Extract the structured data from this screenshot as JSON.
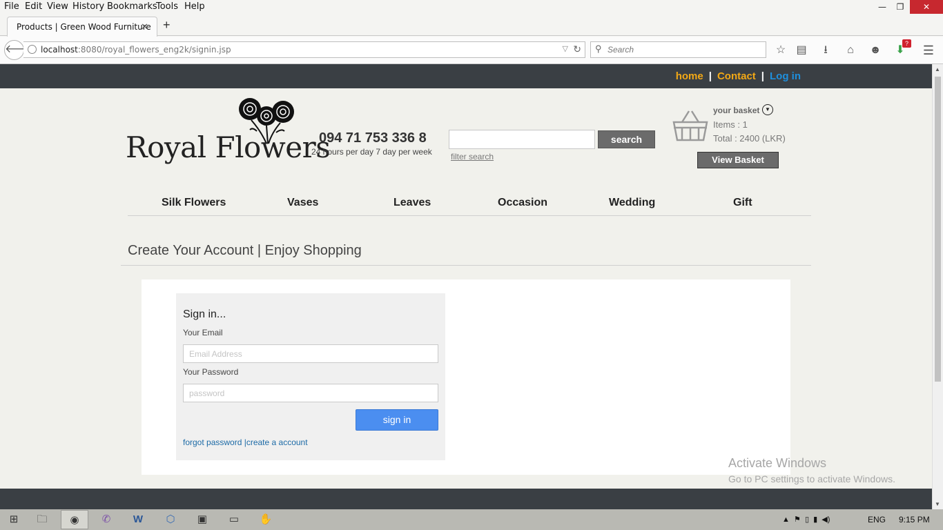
{
  "browser": {
    "menu": [
      "File",
      "Edit",
      "View",
      "History",
      "Bookmarks",
      "Tools",
      "Help"
    ],
    "tab_title": "Products | Green Wood Furniture",
    "url_host": "localhost",
    "url_rest": ":8080/royal_flowers_eng2k/signin.jsp",
    "search_placeholder": "Search",
    "download_badge": "?"
  },
  "site": {
    "topnav": {
      "home": "home",
      "contact": "Contact",
      "login": "Log in",
      "sep": "|"
    },
    "logo_text": "Royal Flowers",
    "phone": "094 71 753 336 8",
    "hours": "24 hours per day 7 day per week",
    "search_button": "search",
    "filter_search": "filter search",
    "basket": {
      "title": "your basket",
      "items": "Items : 1",
      "total": "Total : 2400 (LKR)",
      "view_button": "View Basket"
    },
    "categories": [
      "Silk Flowers",
      "Vases",
      "Leaves",
      "Occasion",
      "Wedding",
      "Gift"
    ],
    "heading": "Create Your Account | Enjoy Shopping"
  },
  "signin": {
    "title": "Sign in...",
    "email_label": "Your Email",
    "email_placeholder": "Email Address",
    "password_label": "Your Password",
    "password_placeholder": "password",
    "button": "sign in",
    "links": "forgot password |create a account"
  },
  "watermark": {
    "line1": "Activate Windows",
    "line2": "Go to PC settings to activate Windows."
  },
  "taskbar": {
    "lang": "ENG",
    "time": "9:15 PM"
  },
  "colors": {
    "accent_orange": "#f2a816",
    "accent_blue": "#1e8fdd",
    "topbar": "#3a3f44",
    "signin_button": "#4b8ef0"
  }
}
